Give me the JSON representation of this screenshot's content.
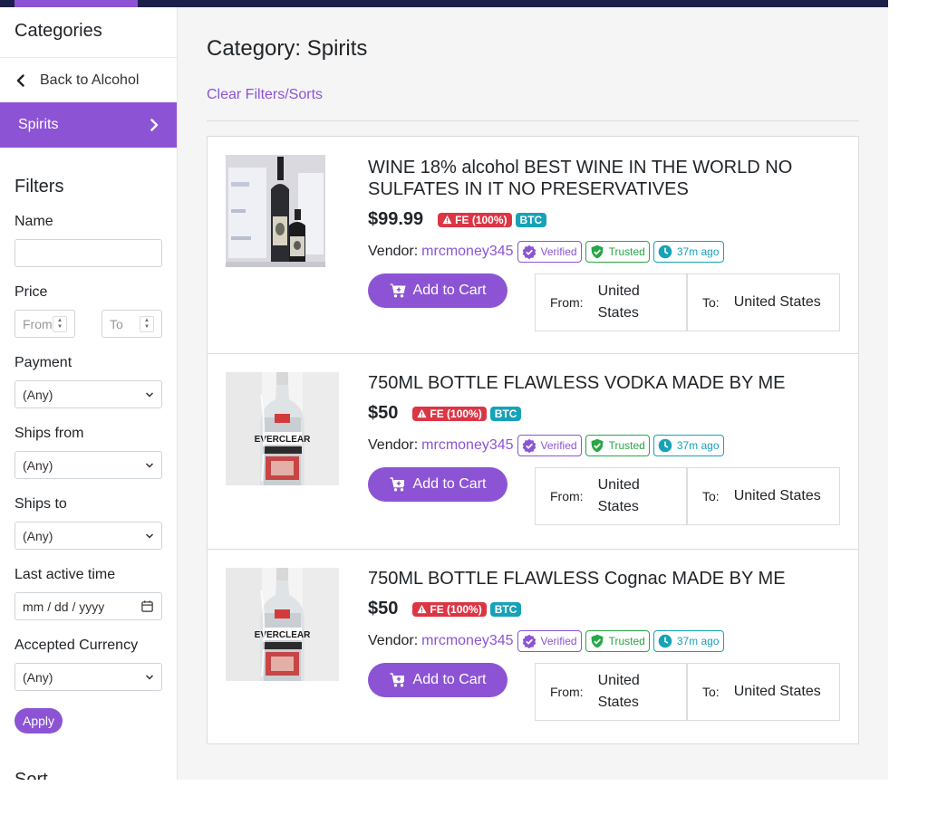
{
  "sidebar": {
    "title": "Categories",
    "back_label": "Back to Alcohol",
    "active_category": "Spirits",
    "filters": {
      "title": "Filters",
      "name_label": "Name",
      "name_value": "",
      "price_label": "Price",
      "price_from_placeholder": "From",
      "price_to_placeholder": "To",
      "payment_label": "Payment",
      "payment_value": "(Any)",
      "ships_from_label": "Ships from",
      "ships_from_value": "(Any)",
      "ships_to_label": "Ships to",
      "ships_to_value": "(Any)",
      "last_active_label": "Last active time",
      "last_active_placeholder": "mm / dd / yyyy",
      "currency_label": "Accepted Currency",
      "currency_value": "(Any)",
      "apply_label": "Apply"
    },
    "sort_title": "Sort"
  },
  "main": {
    "page_title": "Category: Spirits",
    "clear_label": "Clear Filters/Sorts",
    "products": [
      {
        "title": "WINE 18% alcohol BEST WINE IN THE WORLD NO SULFATES IN IT NO PRESERVATIVES",
        "price": "$99.99",
        "fe_badge": "FE (100%)",
        "currency_badge": "BTC",
        "vendor_label": "Vendor:",
        "vendor_name": "mrcmoney345",
        "verified": "Verified",
        "trusted": "Trusted",
        "last_seen": "37m ago",
        "cart_label": "Add to Cart",
        "from_label": "From:",
        "from_value": "United States",
        "to_label": "To:",
        "to_value": "United States",
        "image": "wine-bottles"
      },
      {
        "title": "750ML BOTTLE FLAWLESS VODKA MADE BY ME",
        "price": "$50",
        "fe_badge": "FE (100%)",
        "currency_badge": "BTC",
        "vendor_label": "Vendor:",
        "vendor_name": "mrcmoney345",
        "verified": "Verified",
        "trusted": "Trusted",
        "last_seen": "37m ago",
        "cart_label": "Add to Cart",
        "from_label": "From:",
        "from_value": "United States",
        "to_label": "To:",
        "to_value": "United States",
        "image": "everclear-bottle",
        "label_text": "EVERCLEAR"
      },
      {
        "title": "750ML BOTTLE FLAWLESS Cognac MADE BY ME",
        "price": "$50",
        "fe_badge": "FE (100%)",
        "currency_badge": "BTC",
        "vendor_label": "Vendor:",
        "vendor_name": "mrcmoney345",
        "verified": "Verified",
        "trusted": "Trusted",
        "last_seen": "37m ago",
        "cart_label": "Add to Cart",
        "from_label": "From:",
        "from_value": "United States",
        "to_label": "To:",
        "to_value": "United States",
        "image": "everclear-bottle",
        "label_text": "EVERCLEAR"
      }
    ]
  },
  "colors": {
    "accent": "#8c54d4",
    "topbar": "#1c2048",
    "danger": "#dc3545",
    "info": "#17a2b8",
    "success": "#28a745"
  }
}
